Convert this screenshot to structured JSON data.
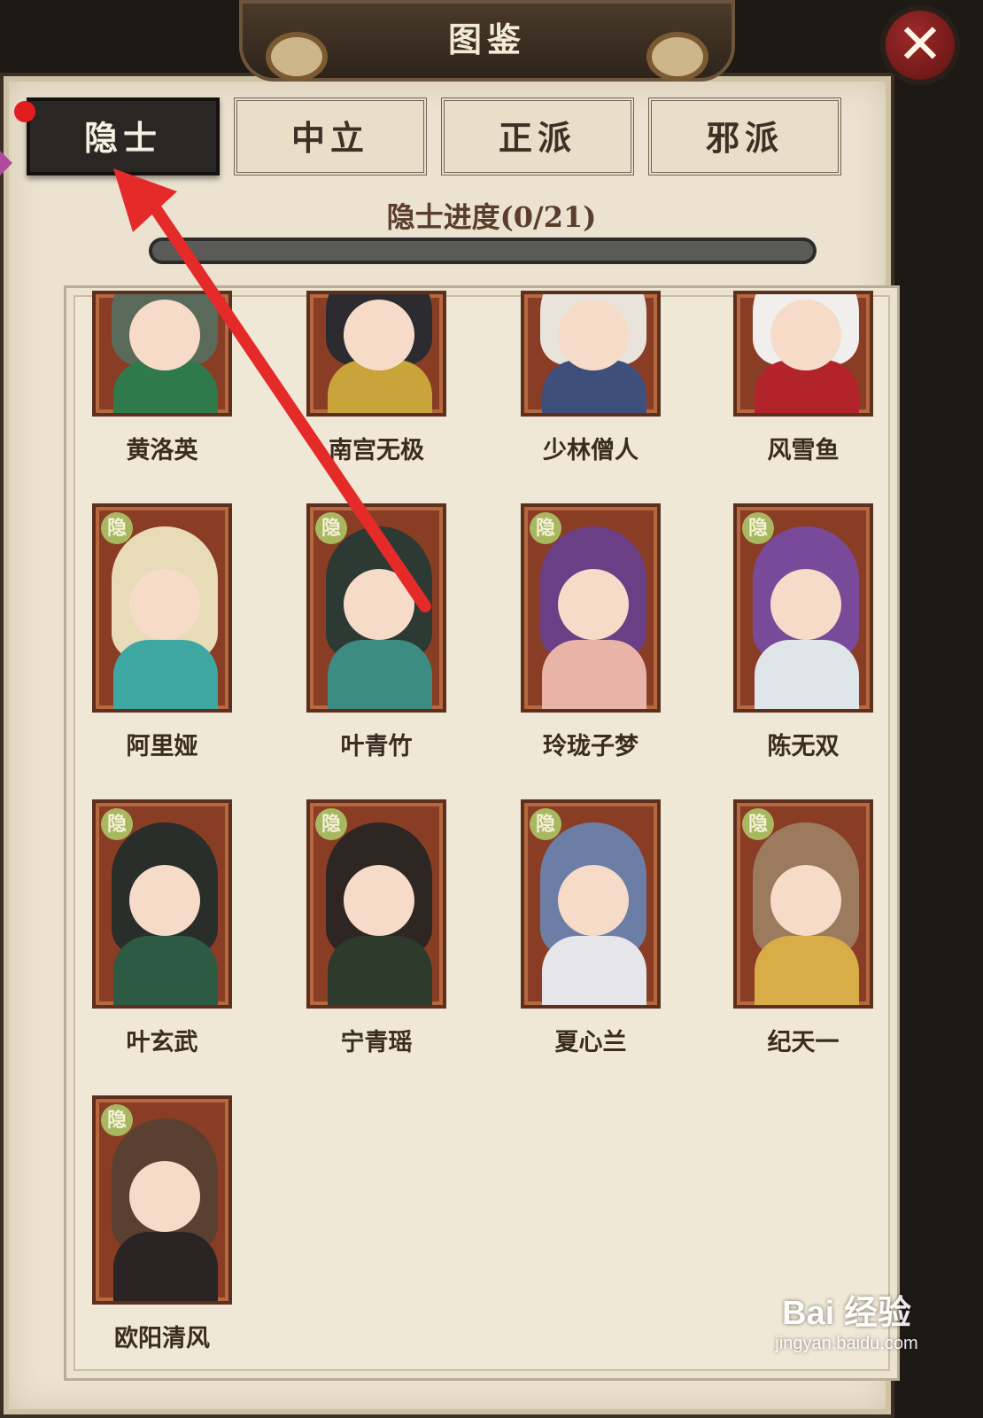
{
  "header": {
    "title": "图鉴",
    "close_icon": "close-x-icon"
  },
  "tabs": [
    {
      "label": "隐士",
      "active": true,
      "has_notification": true
    },
    {
      "label": "中立",
      "active": false
    },
    {
      "label": "正派",
      "active": false
    },
    {
      "label": "邪派",
      "active": false
    }
  ],
  "progress": {
    "label": "隐士进度(0/21)",
    "collected": 0,
    "total": 21,
    "fraction": 0
  },
  "card_badge": "隐",
  "characters": [
    {
      "name": "黄洛英",
      "hair": "#5a6a5a",
      "outfit": "#2f7a4a"
    },
    {
      "name": "南宫无极",
      "hair": "#2c2c30",
      "outfit": "#c9a43a"
    },
    {
      "name": "少林僧人",
      "hair": "#e8e4dc",
      "outfit": "#3d4f7a"
    },
    {
      "name": "风雪鱼",
      "hair": "#f1eeee",
      "outfit": "#b2242a"
    },
    {
      "name": "阿里娅",
      "hair": "#e8dcb8",
      "outfit": "#3fa7a2"
    },
    {
      "name": "叶青竹",
      "hair": "#2c3a33",
      "outfit": "#3d8c82"
    },
    {
      "name": "玲珑子梦",
      "hair": "#6a3f86",
      "outfit": "#e8b4a8"
    },
    {
      "name": "陈无双",
      "hair": "#7a4a9a",
      "outfit": "#dfe6ea"
    },
    {
      "name": "叶玄武",
      "hair": "#2a2e2a",
      "outfit": "#2c5a42"
    },
    {
      "name": "宁青瑶",
      "hair": "#2e2622",
      "outfit": "#2e3a2c"
    },
    {
      "name": "夏心兰",
      "hair": "#6c7ea6",
      "outfit": "#e6e6ea"
    },
    {
      "name": "纪天一",
      "hair": "#9c7a5e",
      "outfit": "#d8ac46"
    },
    {
      "name": "欧阳清风",
      "hair": "#5a4030",
      "outfit": "#2a2424"
    }
  ],
  "watermark": {
    "brand": "Bai 经验",
    "url": "jingyan.baidu.com"
  },
  "colors": {
    "accent_red": "#e21d1d",
    "frame": "#3a3026",
    "parchment": "#ebe2cf"
  }
}
